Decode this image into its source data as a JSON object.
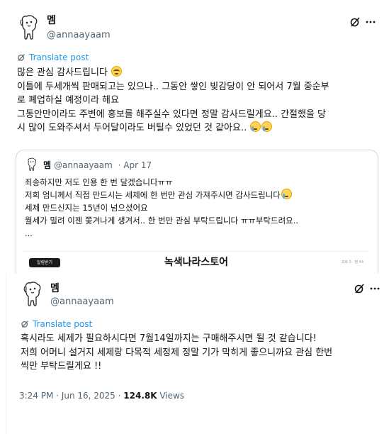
{
  "post1": {
    "name": "멤",
    "handle": "@annaayaam",
    "translate_label": "Translate post",
    "lines": [
      "많은 관심 감사드립니다",
      "이틀에 두세개씩 판매되고는 있으나.. 그동안 쌓인 빚감당이 안 되어서 7월 중순부",
      "로 폐업하실 예정이라 해요",
      "그동안만이라도 주변에 홍보를 해주실수 있다면 정말 감사드릴게요.. 간절했을 당",
      "시 많이 도와주셔서 두어달이라도 버틸수 있었던 것 같아요.."
    ],
    "emojis": {
      "line1": "smiling-face-with-tears-emoji",
      "line5": [
        "crying-face-emoji",
        "crying-face-emoji"
      ]
    },
    "quote": {
      "name": "멤",
      "handle": "@annaayaam",
      "date": "· Apr 17",
      "lines": [
        "죄송하지만 저도 인용 한 번 달겠습니다ㅠㅠ",
        "저희 엄니께서 직접 만드시는 세제에 한 번만 관심 가져주시면 감사드립니다",
        "세제 만드신지는 15년이 넘으셨어요",
        "월세가 밀려 이젠 쫓겨나게 생겨서.. 한 번만 관심 부탁드립니다 ㅠㅠ부탁드려요..",
        "..."
      ],
      "banner_title": "녹색나라스토어",
      "banner_button": "알림받기",
      "banner_right": "조회 3 · 찜 44"
    }
  },
  "post2": {
    "name": "멤",
    "handle": "@annaayaam",
    "translate_label": "Translate post",
    "lines": [
      "혹시라도 세제가 필요하시다면 7월14일까지는 구매해주시면 될 것 같습니다!",
      "저희 어머니 설거지 세제랑 다목적 세정제 정말 기가 막히게 좋으니까요 관심 한번",
      "씩만 부탁드릴게요 !!"
    ],
    "time": "3:24 PM · Jun 16, 2025 ·",
    "views_count": "124.8K",
    "views_label": "Views"
  },
  "icons": [
    "grok-icon",
    "more-icon",
    "translate-icon",
    "avatar-dog-icon"
  ],
  "colors": {
    "link": "#1d9bf0",
    "muted": "#536471",
    "text": "#0f1419",
    "border": "#cfd9de"
  }
}
